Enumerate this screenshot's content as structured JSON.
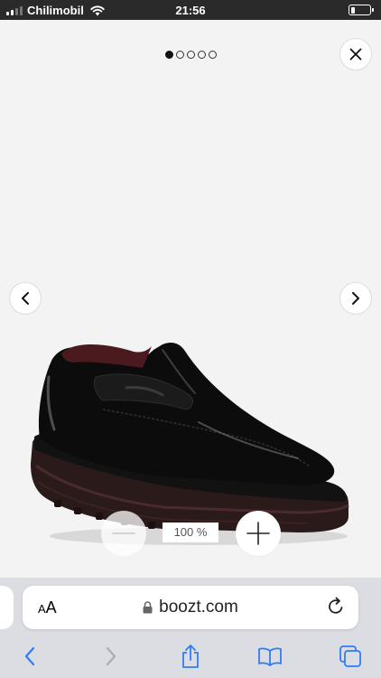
{
  "status_bar": {
    "carrier": "Chilimobil",
    "time": "21:56",
    "battery_level": 0.25
  },
  "gallery": {
    "image_count": 5,
    "active_index": 0,
    "product_image": "black-penny-loafer-shoe",
    "zoom_level": "100 %"
  },
  "browser": {
    "text_size_label_small": "A",
    "text_size_label_large": "A",
    "url": "boozt.com",
    "accent_color": "#2f7cf6"
  },
  "icons": {
    "close": "close-icon",
    "prev": "chevron-left-icon",
    "next": "chevron-right-icon",
    "zoom_out": "minus-icon",
    "zoom_in": "plus-icon",
    "lock": "lock-icon",
    "reload": "reload-icon",
    "back": "back-arrow-icon",
    "forward": "forward-arrow-icon",
    "share": "share-icon",
    "bookmarks": "bookmarks-icon",
    "tabs": "tabs-icon"
  }
}
